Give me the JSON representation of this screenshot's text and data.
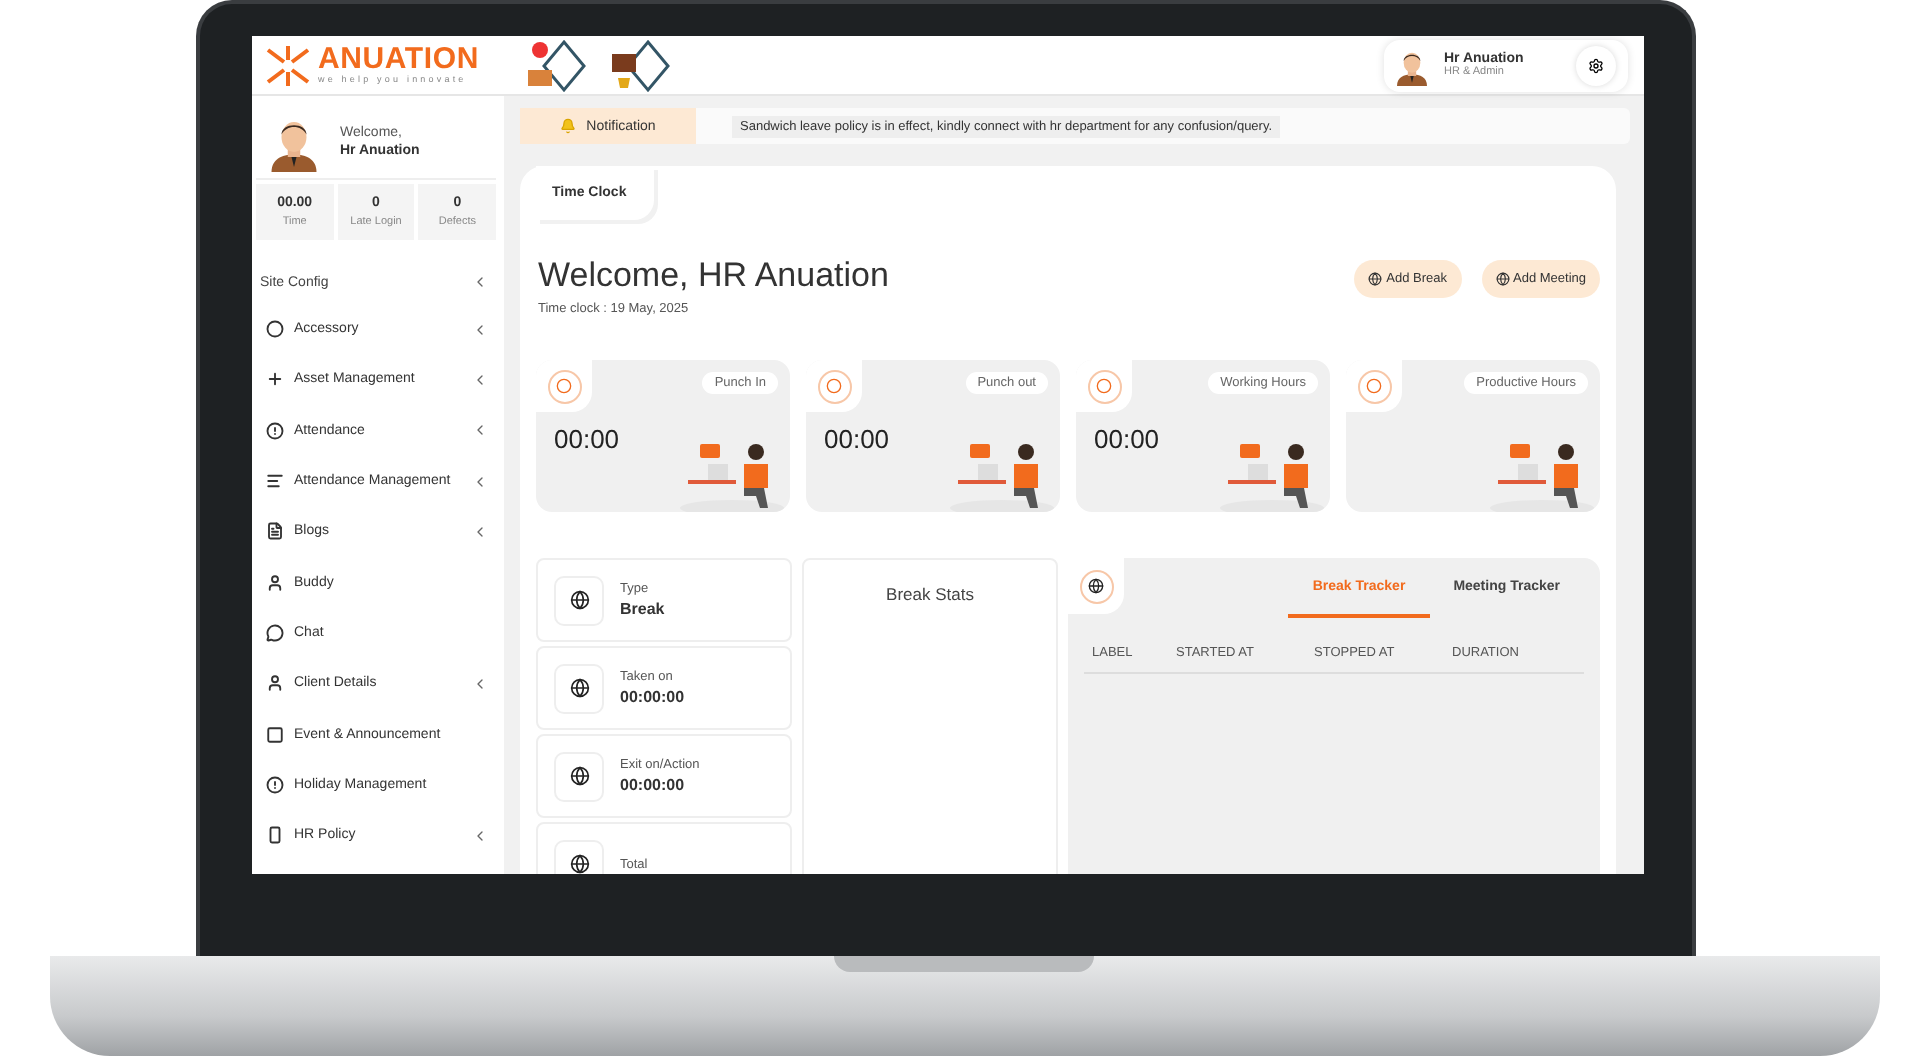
{
  "brand": {
    "name": "ANUATION",
    "tagline": "we help you innovate"
  },
  "user": {
    "name": "Hr Anuation",
    "role": "HR & Admin"
  },
  "profile": {
    "greeting": "Welcome,",
    "name": "Hr Anuation"
  },
  "stats": [
    {
      "value": "00.00",
      "label": "Time"
    },
    {
      "value": "0",
      "label": "Late Login"
    },
    {
      "value": "0",
      "label": "Defects"
    }
  ],
  "sidebar": {
    "section": "Site Config",
    "items": [
      {
        "label": "Accessory",
        "kind": "circle",
        "has_submenu": true
      },
      {
        "label": "Asset Management",
        "kind": "plus",
        "has_submenu": true
      },
      {
        "label": "Attendance",
        "kind": "alert",
        "has_submenu": true
      },
      {
        "label": "Attendance Management",
        "kind": "lines",
        "has_submenu": true
      },
      {
        "label": "Blogs",
        "kind": "doc",
        "has_submenu": true
      },
      {
        "label": "Buddy",
        "kind": "person",
        "has_submenu": false
      },
      {
        "label": "Chat",
        "kind": "chat",
        "has_submenu": false
      },
      {
        "label": "Client Details",
        "kind": "person",
        "has_submenu": true
      },
      {
        "label": "Event & Announcement",
        "kind": "square",
        "has_submenu": false
      },
      {
        "label": "Holiday Management",
        "kind": "alert",
        "has_submenu": false
      },
      {
        "label": "HR Policy",
        "kind": "portrait",
        "has_submenu": true
      }
    ]
  },
  "notification": {
    "label": "Notification",
    "message": "Sandwich leave policy is in effect, kindly connect with hr department for any confusion/query."
  },
  "tabs": [
    {
      "label": "Time Clock",
      "selected": true
    }
  ],
  "welcome": {
    "title": "Welcome, HR Anuation",
    "subtitle": "Time clock : 19 May, 2025"
  },
  "actions": [
    "Add Break",
    "Add Meeting"
  ],
  "time_cards": [
    {
      "label": "Punch In",
      "value": "00:00"
    },
    {
      "label": "Punch out",
      "value": "00:00"
    },
    {
      "label": "Working Hours",
      "value": "00:00"
    },
    {
      "label": "Productive Hours"
    }
  ],
  "break_info": [
    {
      "label": "Type",
      "value": "Break"
    },
    {
      "label": "Taken on",
      "value": "00:00:00"
    },
    {
      "label": "Exit on/Action",
      "value": "00:00:00"
    },
    {
      "label": "Total"
    }
  ],
  "break_stats": {
    "title": "Break Stats"
  },
  "tracker": {
    "tabs": [
      {
        "label": "Break Tracker",
        "selected": true
      },
      {
        "label": "Meeting Tracker",
        "selected": false
      }
    ],
    "columns": [
      "LABEL",
      "STARTED AT",
      "STOPPED AT",
      "DURATION"
    ]
  }
}
